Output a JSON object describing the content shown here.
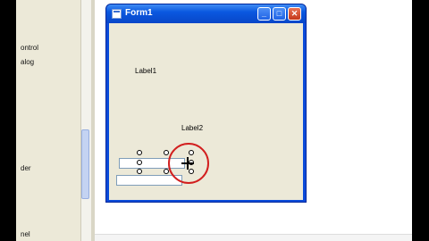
{
  "toolbox": {
    "items": [
      "ontrol",
      "alog",
      "der",
      "nel"
    ]
  },
  "form": {
    "title": "Form1",
    "minimize_label": "_",
    "maximize_label": "□",
    "close_label": "✕",
    "label1": "Label1",
    "label2": "Label2"
  },
  "colors": {
    "titlebar": "#0a58e0",
    "form_client": "#ece9d8",
    "highlight_circle": "#d21f1f"
  }
}
